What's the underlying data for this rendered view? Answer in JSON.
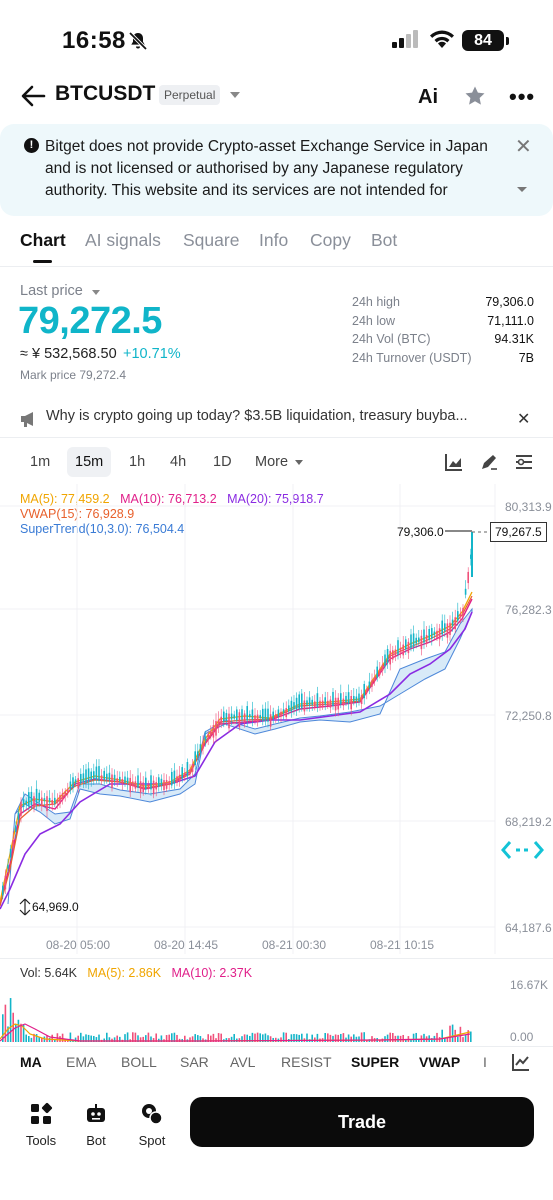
{
  "status_bar": {
    "time": "16:58",
    "battery": "84",
    "bell_icon": "bell-slash-icon",
    "signal_icon": "cellular-signal-icon",
    "wifi_icon": "wifi-icon"
  },
  "header": {
    "pair": "BTCUSDT",
    "badge": "Perpetual",
    "ai_label": "Ai",
    "more_label": "•••"
  },
  "notice": {
    "text": "Bitget does not provide Crypto-asset Exchange Service in Japan and is not licensed or authorised by any Japanese regulatory authority. This website and its services are not intended for individuals residi...",
    "close": "✕"
  },
  "tabs": [
    "Chart",
    "AI signals",
    "Square",
    "Info",
    "Copy",
    "Bot"
  ],
  "price": {
    "label": "Last price",
    "last": "79,272.5",
    "jpy": "≈ ¥ 532,568.50",
    "change": "+10.71%",
    "mark": "Mark price 79,272.4",
    "accent_color": "#10b5c9"
  },
  "stats": [
    {
      "label": "24h high",
      "value": "79,306.0"
    },
    {
      "label": "24h low",
      "value": "71,111.0"
    },
    {
      "label": "24h Vol (BTC)",
      "value": "94.31K"
    },
    {
      "label": "24h Turnover (USDT)",
      "value": "7B"
    }
  ],
  "news": {
    "text": "Why is crypto going up today? $3.5B liquidation, treasury buyba...",
    "close": "✕"
  },
  "intervals": [
    "1m",
    "15m",
    "1h",
    "4h",
    "1D",
    "More"
  ],
  "active_interval": "15m",
  "chart": {
    "legend_ma5": "MA(5): 77,459.2",
    "legend_ma10": "MA(10): 76,713.2",
    "legend_ma20": "MA(20): 75,918.7",
    "legend_vwap": "VWAP(15): 76,928.9",
    "legend_st": "SuperTrend(10,3.0): 76,504.4",
    "y_labels": [
      "80,313.9",
      "76,282.3",
      "72,250.8",
      "68,219.2",
      "64,187.6"
    ],
    "x_labels": [
      "08-20 05:00",
      "08-20 14:45",
      "08-21 00:30",
      "08-21 10:15"
    ],
    "high_marker": "79,306.0",
    "low_marker": "64,969.0",
    "current_price_tag": "79,267.5",
    "colors": {
      "ma5": "#f0a500",
      "ma10": "#e0208a",
      "ma20": "#8a2be2",
      "vwap": "#e8602c",
      "supertrend": "#3a7bd5",
      "up": "#13b5c9",
      "down": "#f0507a"
    }
  },
  "chart_data": {
    "type": "line",
    "title": "",
    "xlabel": "",
    "ylabel": "",
    "ylim": [
      64187.6,
      80313.9
    ],
    "x": [
      "08-20 05:00",
      "08-20 14:45",
      "08-21 00:30",
      "08-21 10:15"
    ],
    "series": [
      {
        "name": "MA(5)",
        "values": [
          68000,
          69500,
          72700,
          75400
        ]
      },
      {
        "name": "MA(10)",
        "values": [
          67800,
          69400,
          72600,
          75200
        ]
      },
      {
        "name": "MA(20)",
        "values": [
          67200,
          68900,
          72200,
          74800
        ]
      }
    ]
  },
  "volume": {
    "vol": "Vol: 5.64K",
    "ma5": "MA(5): 2.86K",
    "ma10": "MA(10): 2.37K",
    "y_top": "16.67K",
    "y_bottom": "0.00"
  },
  "indicators": [
    "MA",
    "EMA",
    "BOLL",
    "SAR",
    "AVL",
    "RESIST",
    "SUPER",
    "VWAP",
    "I"
  ],
  "bottom_nav": [
    {
      "label": "Tools",
      "icon": "tools-grid-icon"
    },
    {
      "label": "Bot",
      "icon": "bot-icon"
    },
    {
      "label": "Spot",
      "icon": "spot-coins-icon"
    }
  ],
  "trade_label": "Trade"
}
